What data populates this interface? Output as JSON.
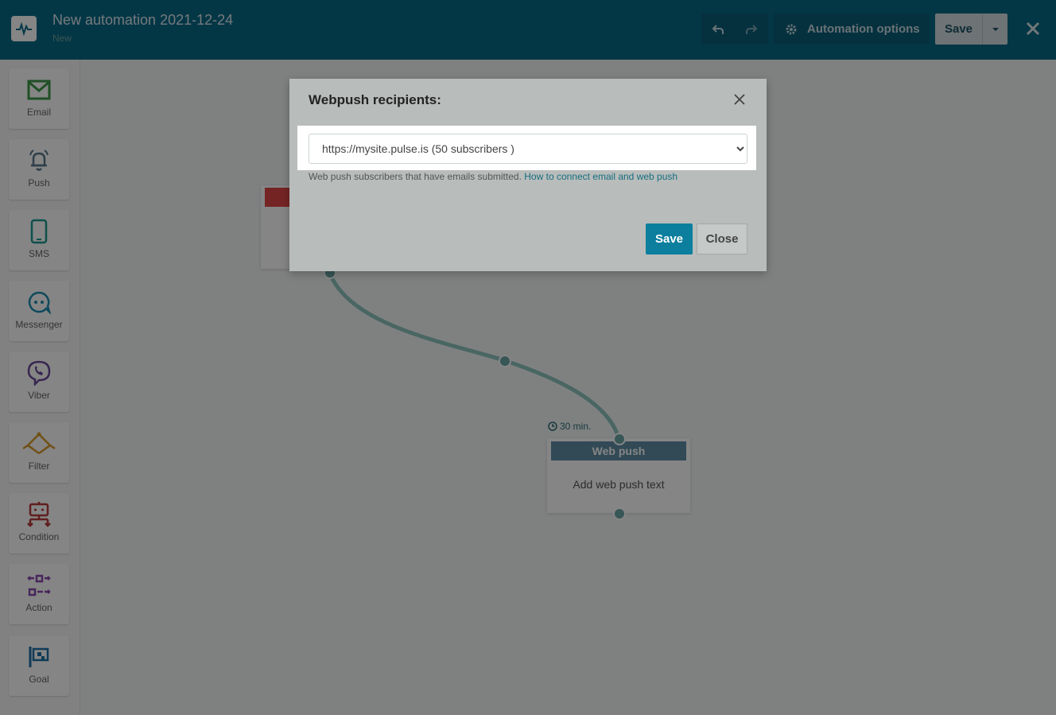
{
  "header": {
    "title": "New automation 2021-12-24",
    "status": "New",
    "automation_options_label": "Automation options",
    "save_label": "Save"
  },
  "sidebar": {
    "items": [
      {
        "label": "Email",
        "icon": "email-icon",
        "color": "#3d9a48"
      },
      {
        "label": "Push",
        "icon": "bell-icon",
        "color": "#5a7a8e"
      },
      {
        "label": "SMS",
        "icon": "phone-icon",
        "color": "#1a9a90"
      },
      {
        "label": "Messenger",
        "icon": "chat-icon",
        "color": "#1e8fb0"
      },
      {
        "label": "Viber",
        "icon": "viber-icon",
        "color": "#6a4a9a"
      },
      {
        "label": "Filter",
        "icon": "filter-icon",
        "color": "#d99a2a"
      },
      {
        "label": "Condition",
        "icon": "condition-icon",
        "color": "#b83a3a"
      },
      {
        "label": "Action",
        "icon": "action-icon",
        "color": "#8a4ab0"
      },
      {
        "label": "Goal",
        "icon": "flag-icon",
        "color": "#1e6fa6"
      }
    ]
  },
  "canvas": {
    "delay_label": "30 min.",
    "webpush_node": {
      "title": "Web push",
      "body": "Add web push text"
    }
  },
  "modal": {
    "title": "Webpush recipients:",
    "select_value": "https://mysite.pulse.is (50 subscribers )",
    "help_text": "Web push subscribers that have emails submitted.",
    "help_link": "How to connect email and web push",
    "save_label": "Save",
    "close_label": "Close"
  }
}
